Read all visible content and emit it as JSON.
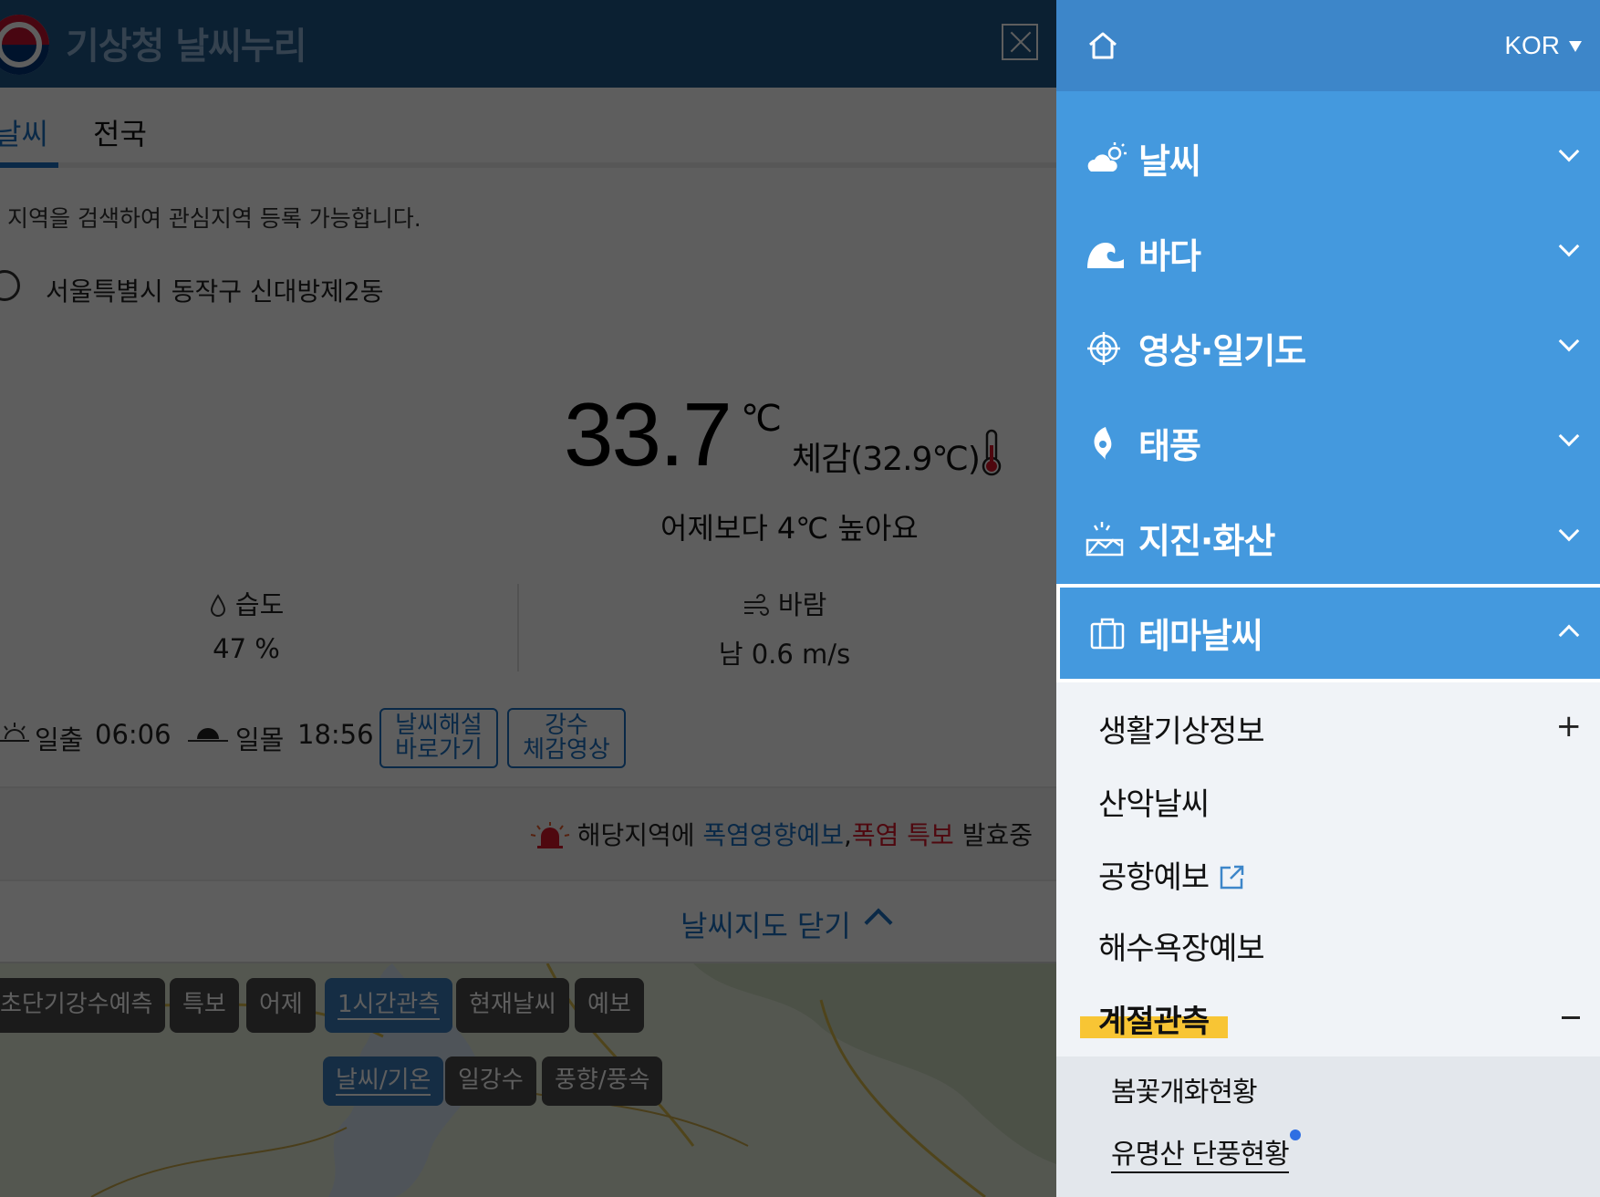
{
  "header": {
    "site_title": "기상청 날씨누리"
  },
  "tabs": [
    {
      "label": "날씨"
    },
    {
      "label": "전국"
    }
  ],
  "hint": "지역을 검색하여 관심지역 등록 가능합니다.",
  "location": "서울특별시 동작구 신대방제2동",
  "current": {
    "temperature": "33.7",
    "unit": "℃",
    "feels_like": "체감(32.9℃)",
    "compare": "어제보다 4℃ 높아요"
  },
  "humidity": {
    "label": "습도",
    "value": "47 %"
  },
  "wind": {
    "label": "바람",
    "value": "남 0.6 m/s"
  },
  "sun": {
    "sunrise_label": "일출",
    "sunrise_time": "06:06",
    "sunset_label": "일몰",
    "sunset_time": "18:56"
  },
  "buttons": {
    "explain_line1": "날씨해설",
    "explain_line2": "바로가기",
    "rain_line1": "강수",
    "rain_line2": "체감영상"
  },
  "alert": {
    "prefix": "해당지역에 ",
    "blue_text": "폭염영향예보",
    "comma": ",",
    "red_text": "폭염 특보",
    "suffix": " 발효중"
  },
  "map_toggle": {
    "label": "날씨지도 닫기"
  },
  "map_buttons_row1": [
    "초단기강수예측",
    "특보",
    "어제",
    "1시간관측",
    "현재날씨",
    "예보"
  ],
  "map_buttons_row2": [
    "날씨/기온",
    "일강수",
    "풍향/풍속"
  ],
  "drawer": {
    "language": "KOR",
    "menu": [
      {
        "label": "날씨"
      },
      {
        "label": "바다"
      },
      {
        "label": "영상·일기도"
      },
      {
        "label": "태풍"
      },
      {
        "label": "지진·화산"
      }
    ],
    "theme": {
      "label": "테마날씨"
    },
    "submenu": [
      {
        "label": "생활기상정보"
      },
      {
        "label": "산악날씨"
      },
      {
        "label": "공항예보"
      },
      {
        "label": "해수욕장예보"
      },
      {
        "label": "계절관측"
      }
    ],
    "subsubmenu": [
      {
        "label": "봄꽃개화현황"
      },
      {
        "label": "유명산 단풍현황"
      }
    ]
  },
  "colors": {
    "header_blue": "#1f5789",
    "menu_blue": "#4499de",
    "accent_blue": "#1b6fc0",
    "alert_red": "#d7182a",
    "highlight_yellow": "#f8c534"
  }
}
